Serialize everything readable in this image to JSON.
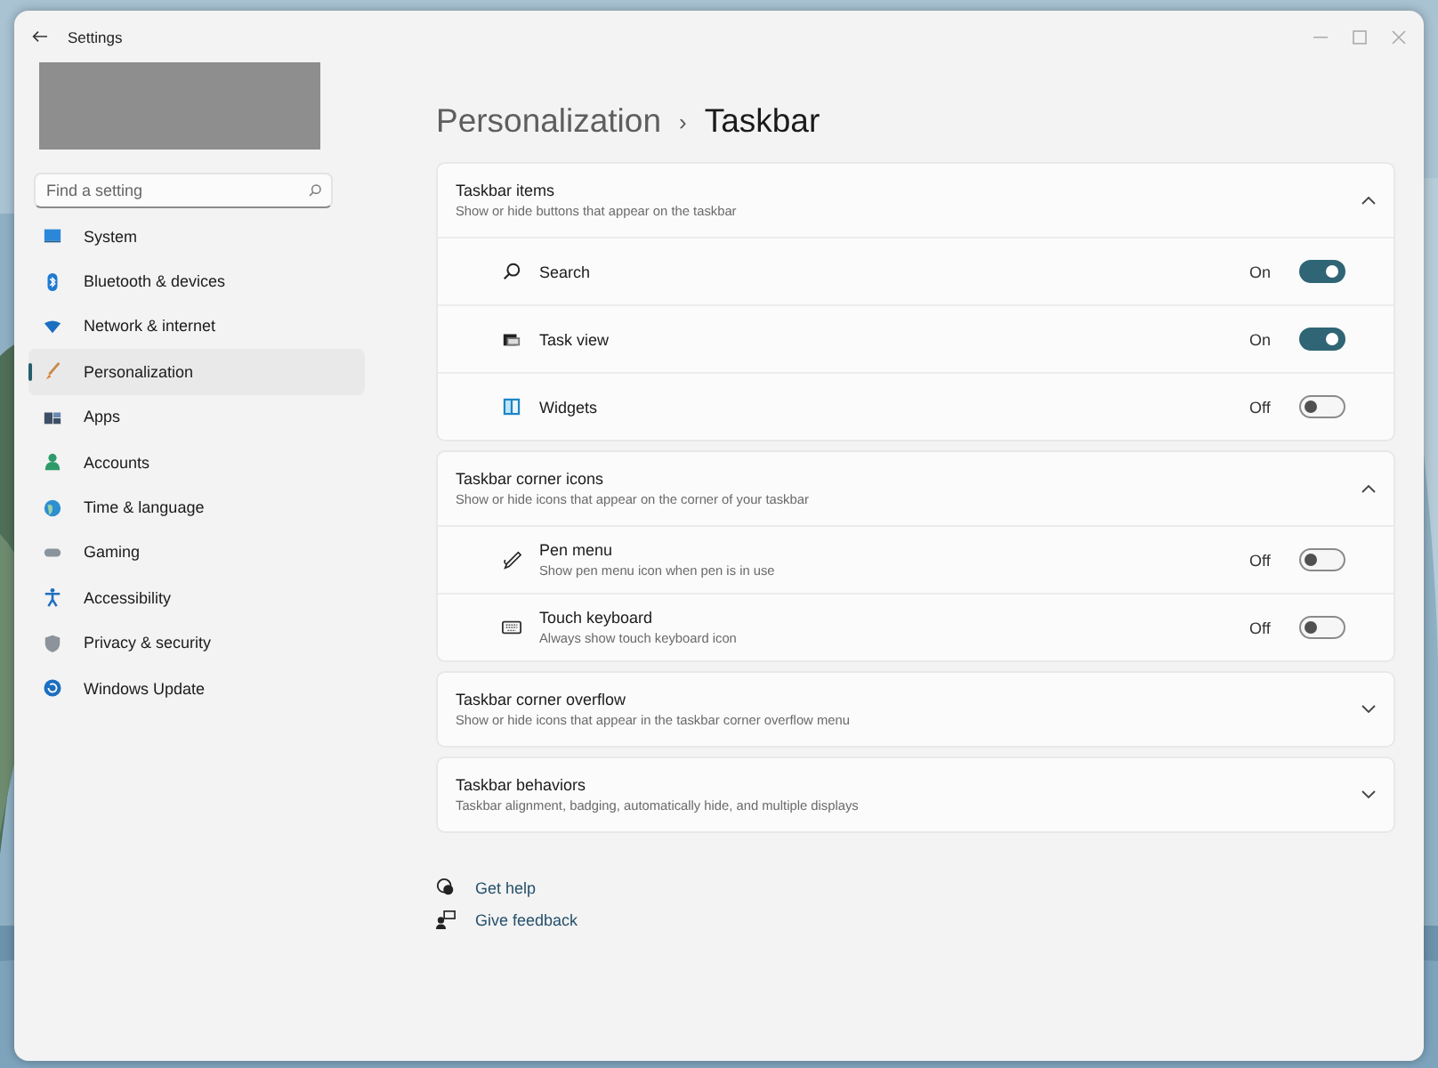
{
  "window": {
    "title": "Settings"
  },
  "sidebar": {
    "search": {
      "placeholder": "Find a setting"
    },
    "items": [
      {
        "label": "System",
        "selected": false
      },
      {
        "label": "Bluetooth & devices",
        "selected": false
      },
      {
        "label": "Network & internet",
        "selected": false
      },
      {
        "label": "Personalization",
        "selected": true
      },
      {
        "label": "Apps",
        "selected": false
      },
      {
        "label": "Accounts",
        "selected": false
      },
      {
        "label": "Time & language",
        "selected": false
      },
      {
        "label": "Gaming",
        "selected": false
      },
      {
        "label": "Accessibility",
        "selected": false
      },
      {
        "label": "Privacy & security",
        "selected": false
      },
      {
        "label": "Windows Update",
        "selected": false
      }
    ]
  },
  "breadcrumb": {
    "parent": "Personalization",
    "separator": "›",
    "current": "Taskbar"
  },
  "sections": [
    {
      "title": "Taskbar items",
      "subtitle": "Show or hide buttons that appear on the taskbar",
      "expanded": true,
      "items": [
        {
          "label": "Search",
          "on": true,
          "state": "On"
        },
        {
          "label": "Task view",
          "on": true,
          "state": "On"
        },
        {
          "label": "Widgets",
          "on": false,
          "state": "Off"
        }
      ]
    },
    {
      "title": "Taskbar corner icons",
      "subtitle": "Show or hide icons that appear on the corner of your taskbar",
      "expanded": true,
      "items": [
        {
          "label": "Pen menu",
          "description": "Show pen menu icon when pen is in use",
          "on": false,
          "state": "Off"
        },
        {
          "label": "Touch keyboard",
          "description": "Always show touch keyboard icon",
          "on": false,
          "state": "Off"
        }
      ]
    },
    {
      "title": "Taskbar corner overflow",
      "subtitle": "Show or hide icons that appear in the taskbar corner overflow menu",
      "expanded": false
    },
    {
      "title": "Taskbar behaviors",
      "subtitle": "Taskbar alignment, badging, automatically hide, and multiple displays",
      "expanded": false
    }
  ],
  "links": [
    "Get help",
    "Give feedback"
  ]
}
